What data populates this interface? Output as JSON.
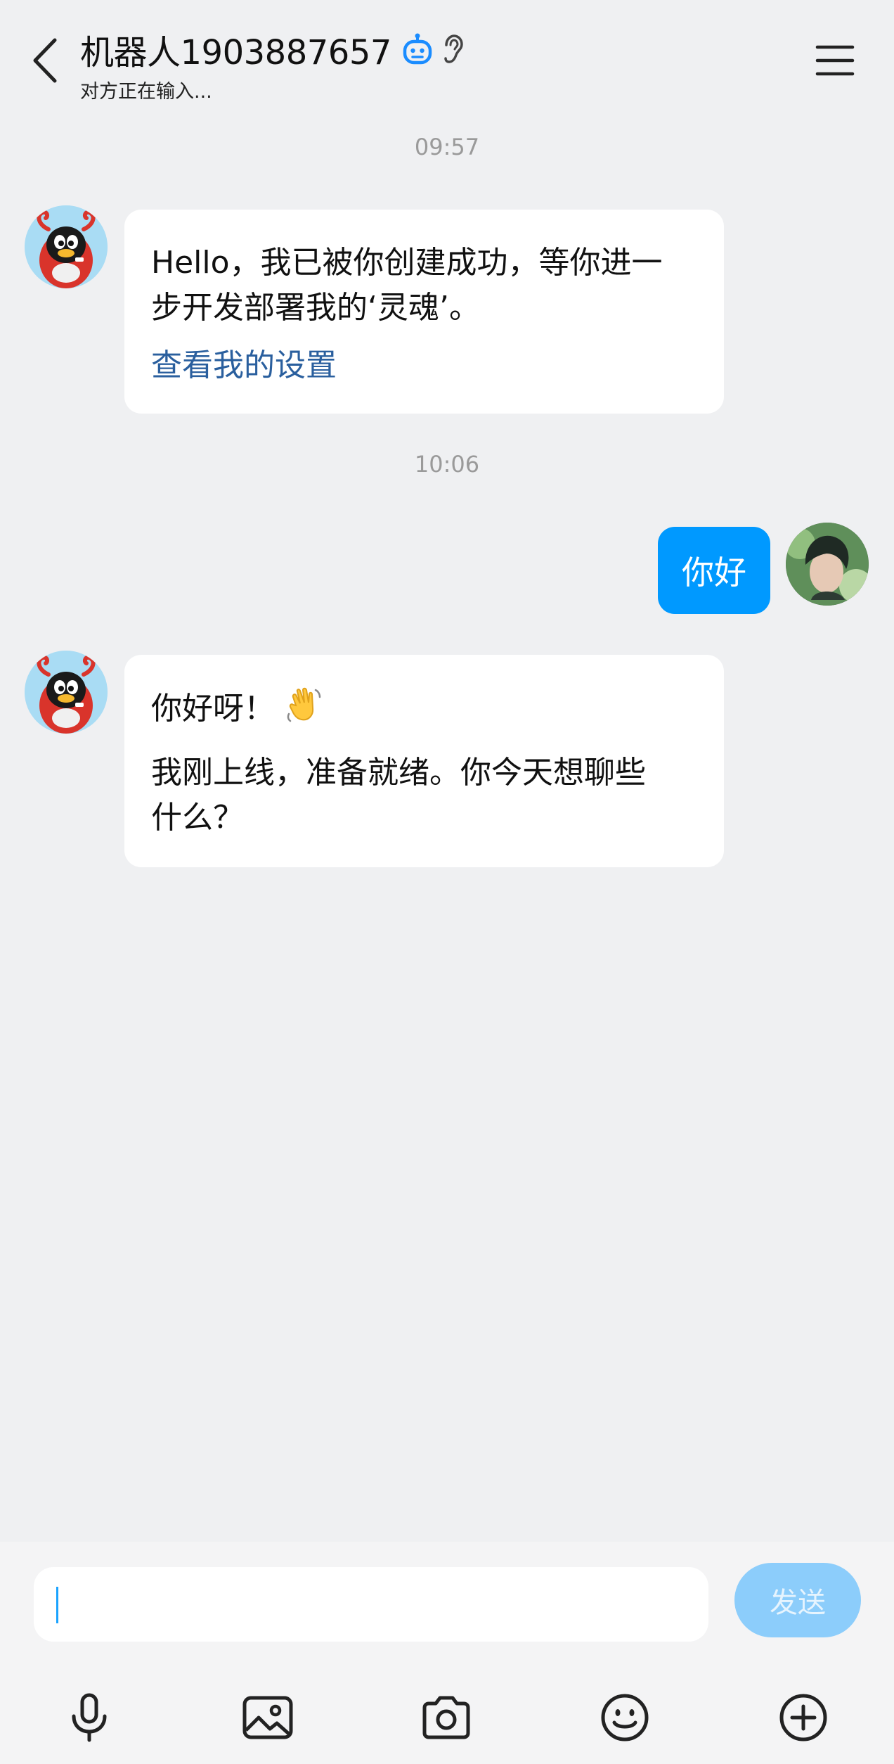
{
  "header": {
    "title": "机器人1903887657",
    "subtitle": "对方正在输入...",
    "back_icon": "chevron-left-icon",
    "robot_badge_icon": "robot-icon",
    "ear_icon": "ear-icon",
    "menu_icon": "hamburger-menu-icon"
  },
  "messages": [
    {
      "timestamp": "09:57"
    },
    {
      "from": "bot",
      "lines": [
        "Hello，我已被你创建成功，等你进一",
        "步开发部署我的‘灵魂’。"
      ],
      "link": "查看我的设置"
    },
    {
      "timestamp": "10:06"
    },
    {
      "from": "user",
      "text": "你好"
    },
    {
      "from": "bot",
      "lines": [
        "你好呀！",
        "我刚上线，准备就绪。你今天想聊些",
        "什么？"
      ],
      "emoji": "👋"
    }
  ],
  "composer": {
    "send_label": "发送",
    "input_value": "",
    "toolbar": [
      "microphone-icon",
      "image-icon",
      "camera-icon",
      "emoji-icon",
      "plus-icon"
    ]
  },
  "colors": {
    "background": "#eff0f2",
    "outgoing_bubble": "#0099ff",
    "link": "#2a5f9e",
    "send_button_disabled": "#8ccdfb",
    "bot_badge": "#1a8cff"
  }
}
